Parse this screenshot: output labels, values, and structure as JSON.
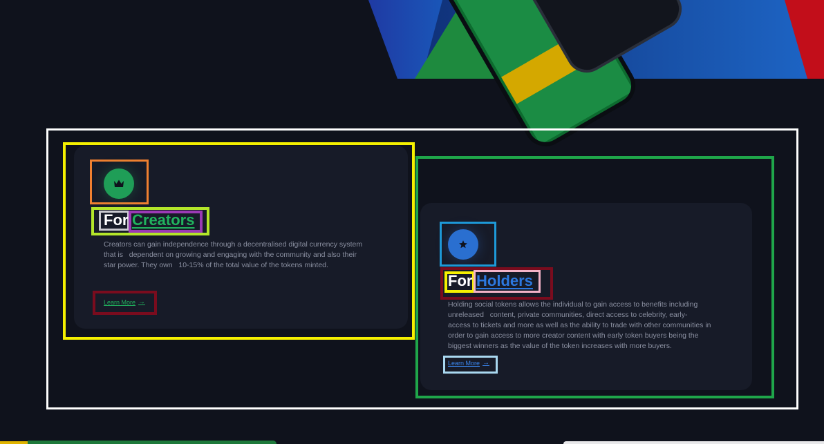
{
  "colors": {
    "background": "#0f121c",
    "card": "#171b28",
    "creators_accent": "#21b35e",
    "holders_accent": "#2c78e0",
    "body_text": "#8a8fa0"
  },
  "cards": {
    "creators": {
      "icon": "crown-icon",
      "title_prefix": "For",
      "title_accent": "Creators",
      "description": "Creators can gain independence through a decentralised digital currency system\nthat is   dependent on growing and engaging with the community and also their\nstar power. They own   10-15% of the total value of the tokens minted.",
      "link_label": "Learn More",
      "link_icon": "arrow-right-icon"
    },
    "holders": {
      "icon": "star-icon",
      "title_prefix": "For",
      "title_accent": "Holders",
      "description": "Holding social tokens allows the individual to gain access to benefits including\nunreleased   content, private communities, direct access to celebrity, early-\naccess to tickets and more as well as the ability to trade with other communities in\norder to gain access to more creator content with early token buyers being the\nbiggest winners as the value of the token increases with more buyers.",
      "link_label": "Learn More",
      "link_icon": "arrow-right-icon"
    }
  }
}
